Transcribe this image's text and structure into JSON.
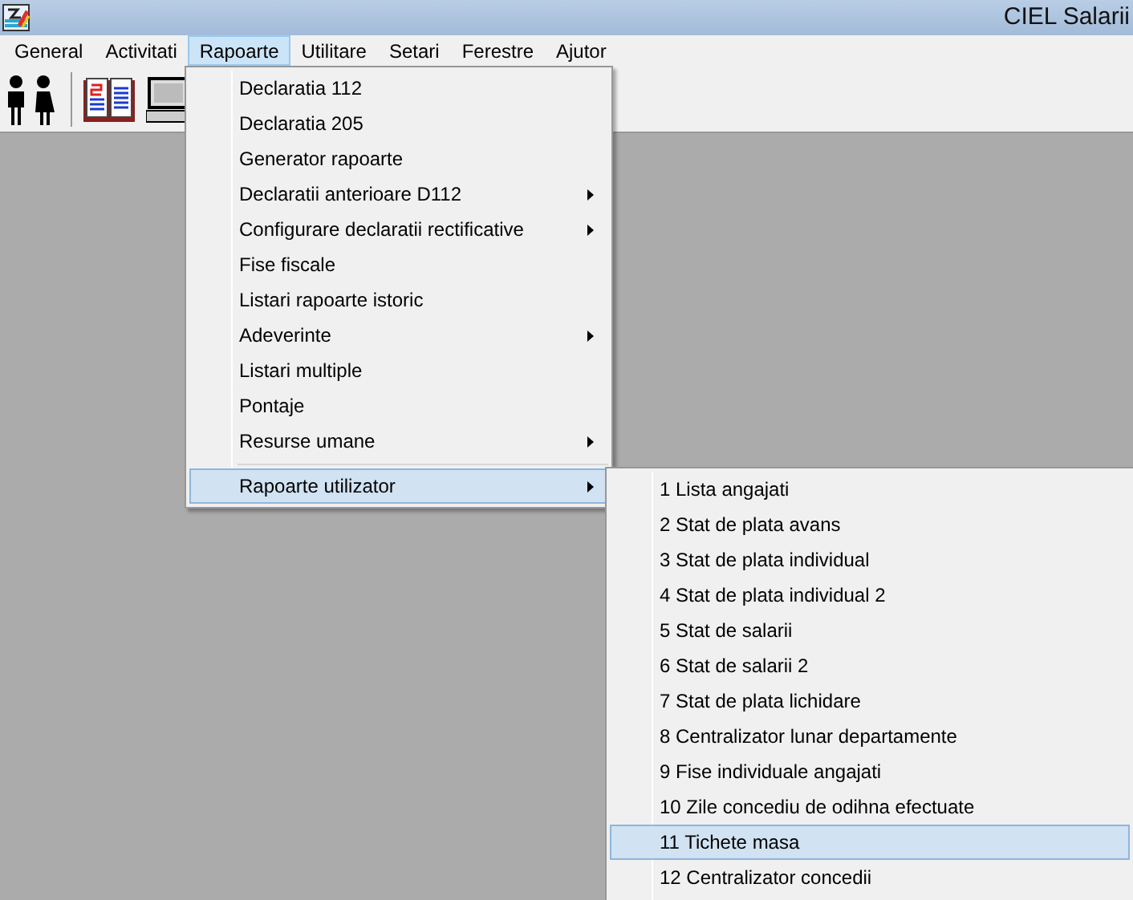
{
  "window": {
    "title": "CIEL Salarii"
  },
  "menu_bar": [
    {
      "label": "General",
      "selected": false
    },
    {
      "label": "Activitati",
      "selected": false
    },
    {
      "label": "Rapoarte",
      "selected": true
    },
    {
      "label": "Utilitare",
      "selected": false
    },
    {
      "label": "Setari",
      "selected": false
    },
    {
      "label": "Ferestre",
      "selected": false
    },
    {
      "label": "Ajutor",
      "selected": false
    }
  ],
  "rapoarte_menu": [
    {
      "label": "Declaratia 112",
      "has_submenu": false,
      "selected": false
    },
    {
      "label": "Declaratia 205",
      "has_submenu": false,
      "selected": false
    },
    {
      "label": "Generator rapoarte",
      "has_submenu": false,
      "selected": false
    },
    {
      "label": "Declaratii anterioare D112",
      "has_submenu": true,
      "selected": false
    },
    {
      "label": "Configurare declaratii rectificative",
      "has_submenu": true,
      "selected": false
    },
    {
      "label": "Fise fiscale",
      "has_submenu": false,
      "selected": false
    },
    {
      "label": "Listari rapoarte istoric",
      "has_submenu": false,
      "selected": false
    },
    {
      "label": "Adeverinte",
      "has_submenu": true,
      "selected": false
    },
    {
      "label": "Listari multiple",
      "has_submenu": false,
      "selected": false
    },
    {
      "label": "Pontaje",
      "has_submenu": false,
      "selected": false
    },
    {
      "label": "Resurse umane",
      "has_submenu": true,
      "selected": false
    },
    {
      "label": "Rapoarte utilizator",
      "has_submenu": true,
      "selected": true,
      "separator_before": true
    }
  ],
  "rapoarte_utilizator_submenu": [
    {
      "label": "1 Lista angajati",
      "selected": false
    },
    {
      "label": "2 Stat de plata avans",
      "selected": false
    },
    {
      "label": "3 Stat de plata individual",
      "selected": false
    },
    {
      "label": "4 Stat de plata individual 2",
      "selected": false
    },
    {
      "label": "5 Stat de salarii",
      "selected": false
    },
    {
      "label": "6 Stat de salarii 2",
      "selected": false
    },
    {
      "label": "7 Stat de plata lichidare",
      "selected": false
    },
    {
      "label": "8 Centralizator lunar departamente",
      "selected": false
    },
    {
      "label": "9 Fise individuale angajati",
      "selected": false
    },
    {
      "label": "10 Zile concediu de odihna efectuate",
      "selected": false
    },
    {
      "label": "11 Tichete masa",
      "selected": true
    },
    {
      "label": "12 Centralizator concedii",
      "selected": false
    }
  ]
}
